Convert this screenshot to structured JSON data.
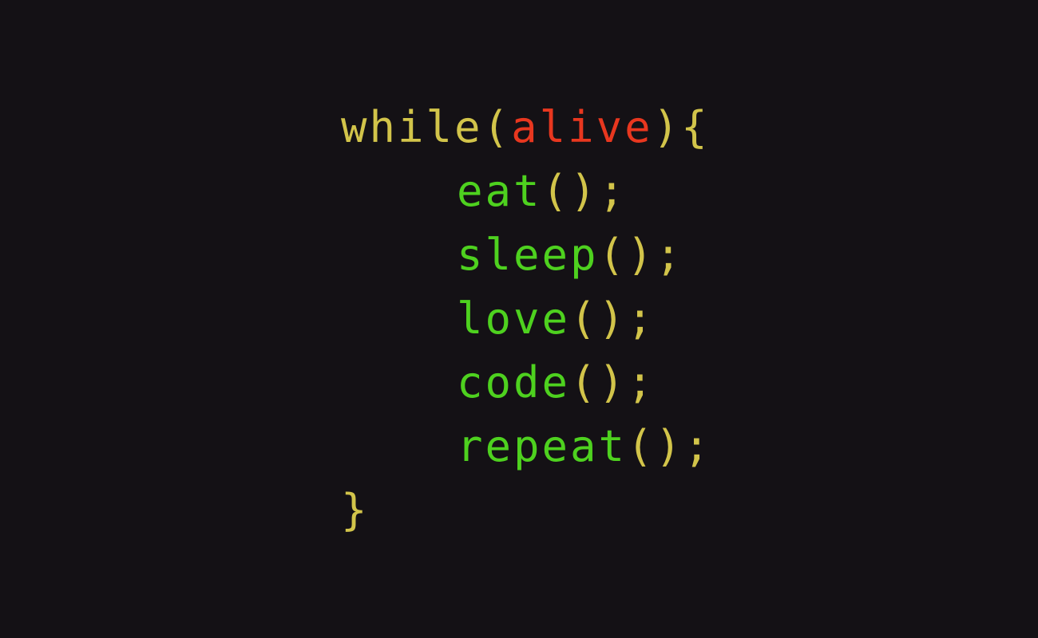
{
  "colors": {
    "background": "#141115",
    "keyword": "#d2c44a",
    "variable": "#e8371f",
    "function": "#4ed11f",
    "punctuation": "#d2c44a"
  },
  "code": {
    "line1": {
      "keyword": "while",
      "open_paren": "(",
      "condition": "alive",
      "close_paren": ")",
      "open_brace": "{"
    },
    "calls": [
      {
        "name": "eat",
        "parens": "()",
        "semicolon": ";"
      },
      {
        "name": "sleep",
        "parens": "()",
        "semicolon": ";"
      },
      {
        "name": "love",
        "parens": "()",
        "semicolon": ";"
      },
      {
        "name": "code",
        "parens": "()",
        "semicolon": ";"
      },
      {
        "name": "repeat",
        "parens": "()",
        "semicolon": ";"
      }
    ],
    "close_brace": "}"
  }
}
